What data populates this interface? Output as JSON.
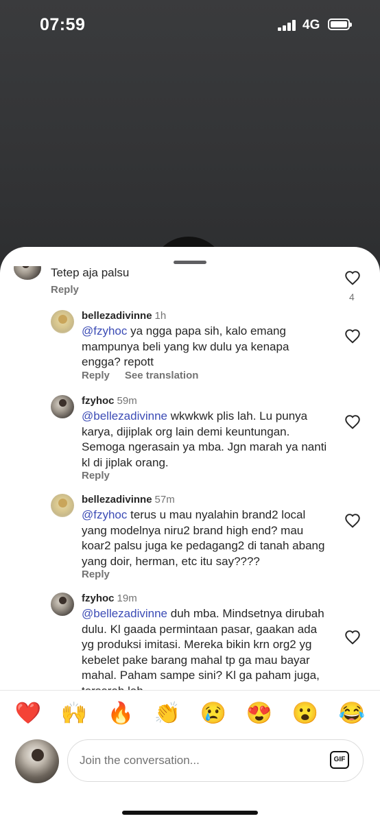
{
  "status_bar": {
    "time": "07:59",
    "network": "4G"
  },
  "comments": [
    {
      "id": "top",
      "text": "Tetep aja palsu",
      "reply_label": "Reply",
      "likes": "4"
    },
    {
      "id": "c1",
      "username": "bellezadivinne",
      "time": "1h",
      "mention": "@fzyhoc",
      "text": " ya ngga papa sih, kalo emang mampunya beli yang kw dulu ya kenapa engga? repott",
      "reply_label": "Reply",
      "translate_label": "See translation"
    },
    {
      "id": "c2",
      "username": "fzyhoc",
      "time": "59m",
      "mention": "@bellezadivinne",
      "text": " wkwkwk plis lah. Lu punya karya, dijiplak org lain demi keuntungan. Semoga ngerasain ya mba. Jgn marah ya nanti kl di jiplak orang.",
      "reply_label": "Reply"
    },
    {
      "id": "c3",
      "username": "bellezadivinne",
      "time": "57m",
      "mention": "@fzyhoc",
      "text": " terus u mau nyalahin brand2 local yang modelnya niru2 brand high end? mau koar2 palsu juga ke pedagang2 di tanah abang yang doir, herman, etc itu say????",
      "reply_label": "Reply"
    },
    {
      "id": "c4",
      "username": "fzyhoc",
      "time": "19m",
      "mention": "@bellezadivinne",
      "text": " duh mba. Mindsetnya dirubah dulu. Kl gaada permintaan pasar, gaakan ada yg produksi imitasi. Mereka bikin krn org2 yg kebelet pake barang mahal tp ga mau bayar mahal. Paham sampe sini? Kl ga paham juga, terserah lah."
    }
  ],
  "emojis": [
    "❤️",
    "🙌",
    "🔥",
    "👏",
    "😢",
    "😍",
    "😮",
    "😂"
  ],
  "composer": {
    "placeholder": "Join the conversation...",
    "gif_label": "GIF"
  }
}
